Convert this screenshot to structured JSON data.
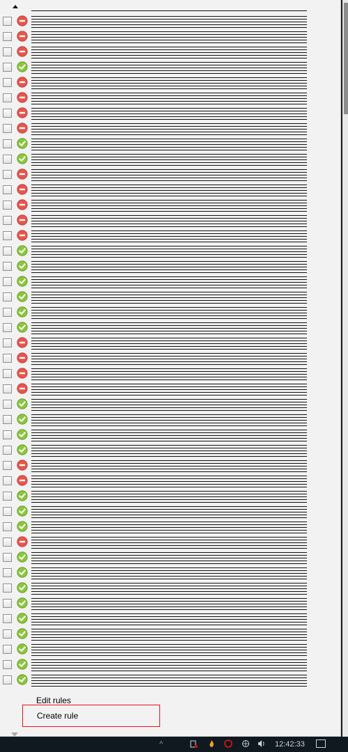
{
  "menu": {
    "scroll_up_icon": "triangle-up-icon",
    "scroll_down_icon": "triangle-down-icon",
    "edit_rules_label": "Edit rules",
    "create_rule_label": "Create rule"
  },
  "rules": [
    {
      "status": "blocked"
    },
    {
      "status": "blocked"
    },
    {
      "status": "blocked"
    },
    {
      "status": "allowed"
    },
    {
      "status": "blocked"
    },
    {
      "status": "blocked"
    },
    {
      "status": "blocked"
    },
    {
      "status": "blocked"
    },
    {
      "status": "allowed"
    },
    {
      "status": "allowed"
    },
    {
      "status": "blocked"
    },
    {
      "status": "blocked"
    },
    {
      "status": "blocked"
    },
    {
      "status": "blocked"
    },
    {
      "status": "blocked"
    },
    {
      "status": "allowed"
    },
    {
      "status": "allowed"
    },
    {
      "status": "allowed"
    },
    {
      "status": "allowed"
    },
    {
      "status": "allowed"
    },
    {
      "status": "allowed"
    },
    {
      "status": "blocked"
    },
    {
      "status": "blocked"
    },
    {
      "status": "blocked"
    },
    {
      "status": "blocked"
    },
    {
      "status": "allowed"
    },
    {
      "status": "allowed"
    },
    {
      "status": "allowed"
    },
    {
      "status": "allowed"
    },
    {
      "status": "blocked"
    },
    {
      "status": "blocked"
    },
    {
      "status": "allowed"
    },
    {
      "status": "allowed"
    },
    {
      "status": "allowed"
    },
    {
      "status": "blocked"
    },
    {
      "status": "allowed"
    },
    {
      "status": "allowed"
    },
    {
      "status": "allowed"
    },
    {
      "status": "allowed"
    },
    {
      "status": "allowed"
    },
    {
      "status": "allowed"
    },
    {
      "status": "allowed"
    },
    {
      "status": "allowed"
    },
    {
      "status": "allowed"
    }
  ],
  "colors": {
    "allowed": "#8cc63f",
    "blocked": "#e8554e",
    "highlight_border": "#e8101a"
  },
  "taskbar": {
    "chevron": "^",
    "time": "12:42:33"
  }
}
